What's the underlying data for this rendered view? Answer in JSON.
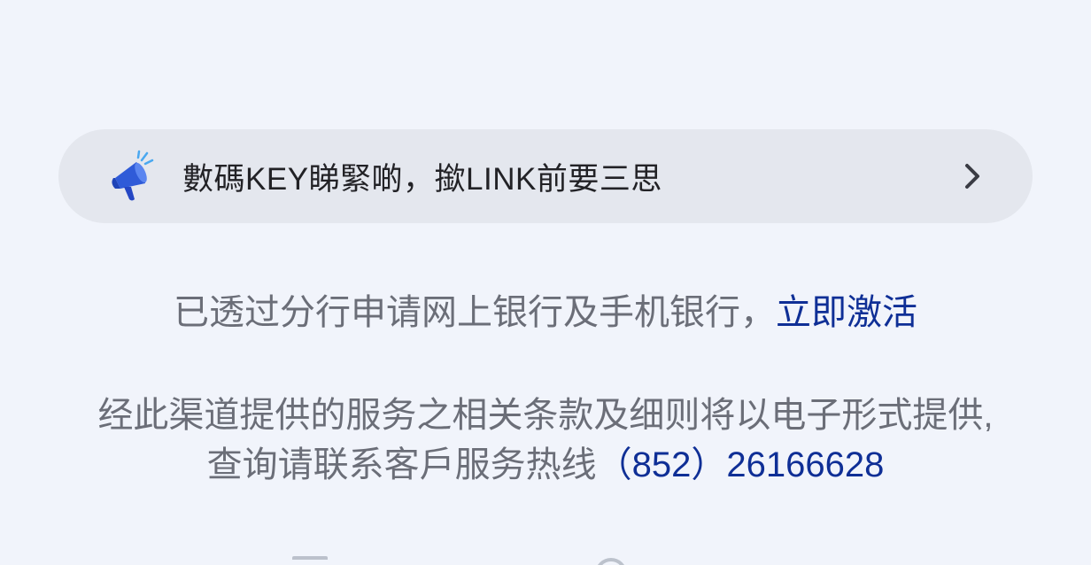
{
  "notice": {
    "icon": "megaphone-icon",
    "text": "數碼KEY睇緊啲，撳LINK前要三思",
    "chevron_icon": "chevron-right-icon"
  },
  "activation": {
    "prefix": "已透过分行申请网上银行及手机银行，",
    "link_label": "立即激活"
  },
  "terms": {
    "line1": "经此渠道提供的服务之相关条款及细则将以电子形式提供,",
    "line2_prefix": "查询请联系客戶服务热线",
    "hotline": "（852）26166628"
  },
  "colors": {
    "background": "#f1f4fb",
    "notice_bg": "#e4e7ee",
    "link": "#0f2f96",
    "muted_text": "#6b6e78",
    "icon_blue": "#2f5bd8"
  }
}
